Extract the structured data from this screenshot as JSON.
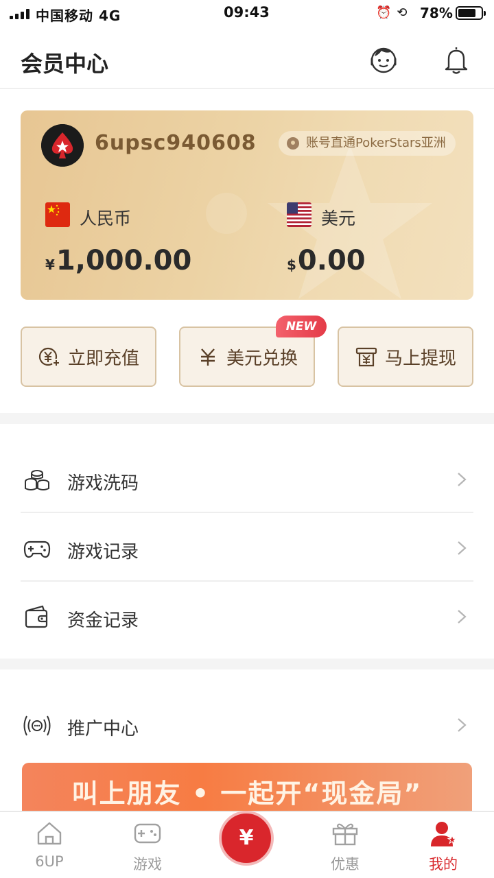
{
  "status_bar": {
    "carrier": "中国移动 4G",
    "time": "09:43",
    "battery": "78%",
    "battery_level": 0.78
  },
  "header": {
    "title": "会员中心",
    "support_icon": "customer-service-icon",
    "bell_icon": "bell-icon"
  },
  "account": {
    "username": "6upsc940608",
    "badge": "账号直通PokerStars亚洲",
    "currencies": [
      {
        "name": "人民币",
        "symbol": "¥",
        "amount": "1,000.00",
        "flag": "cn-flag-icon"
      },
      {
        "name": "美元",
        "symbol": "$",
        "amount": "0.00",
        "flag": "us-flag-icon"
      }
    ]
  },
  "actions": [
    {
      "label": "立即充值",
      "icon": "yuan-plus-icon"
    },
    {
      "label": "美元兑换",
      "icon": "yuan-icon",
      "badge": "NEW"
    },
    {
      "label": "马上提现",
      "icon": "withdraw-icon"
    }
  ],
  "menu": [
    {
      "label": "游戏洗码",
      "icon": "coins-icon"
    },
    {
      "label": "游戏记录",
      "icon": "gamepad-icon"
    },
    {
      "label": "资金记录",
      "icon": "wallet-icon"
    },
    {
      "label": "推广中心",
      "icon": "broadcast-icon"
    }
  ],
  "banner": {
    "text": "叫上朋友 • 一起开“现金局”"
  },
  "tabbar": {
    "tabs": [
      {
        "label": "6UP",
        "icon": "home-icon"
      },
      {
        "label": "游戏",
        "icon": "gamepad-icon"
      },
      {
        "label": "",
        "icon": "yuan-icon",
        "symbol": "¥"
      },
      {
        "label": "优惠",
        "icon": "gift-icon"
      },
      {
        "label": "我的",
        "icon": "user-icon"
      }
    ],
    "active_index": 4
  },
  "colors": {
    "accent_red": "#d8262a",
    "card_gold": "#ecd3a5",
    "username_brown": "#7a5a33"
  }
}
